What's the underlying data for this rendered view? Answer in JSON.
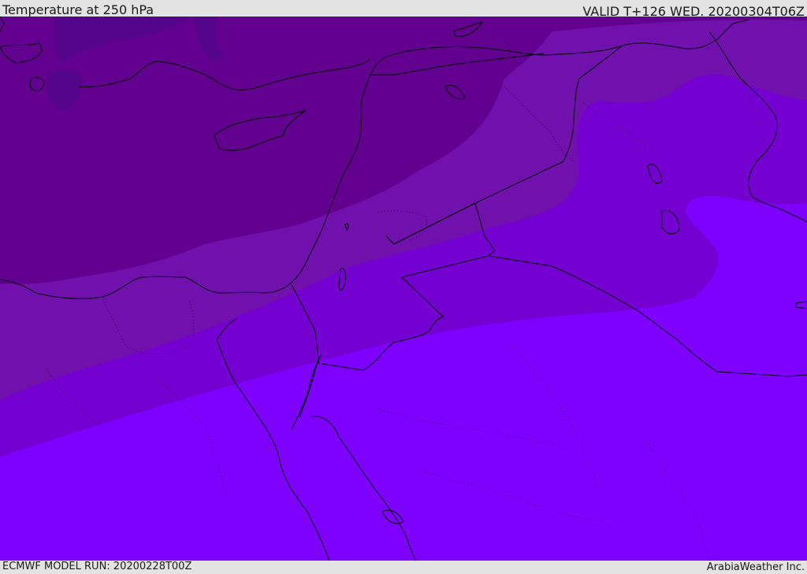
{
  "header": {
    "title": "Temperature at 250 hPa",
    "valid_time": "VALID T+126 WED. 20200304T06Z"
  },
  "footer": {
    "model_run": "ECMWF MODEL RUN: 20200228T00Z",
    "credit": "ArabiaWeather Inc."
  },
  "map": {
    "field": "temperature",
    "level": "250 hPa",
    "palette": {
      "coldest": "#4f0b7b",
      "colder": "#62008f",
      "cold": "#7010ad",
      "mid": "#7400d2",
      "warm": "#7e00ff"
    },
    "coastline_color": "#000000"
  }
}
